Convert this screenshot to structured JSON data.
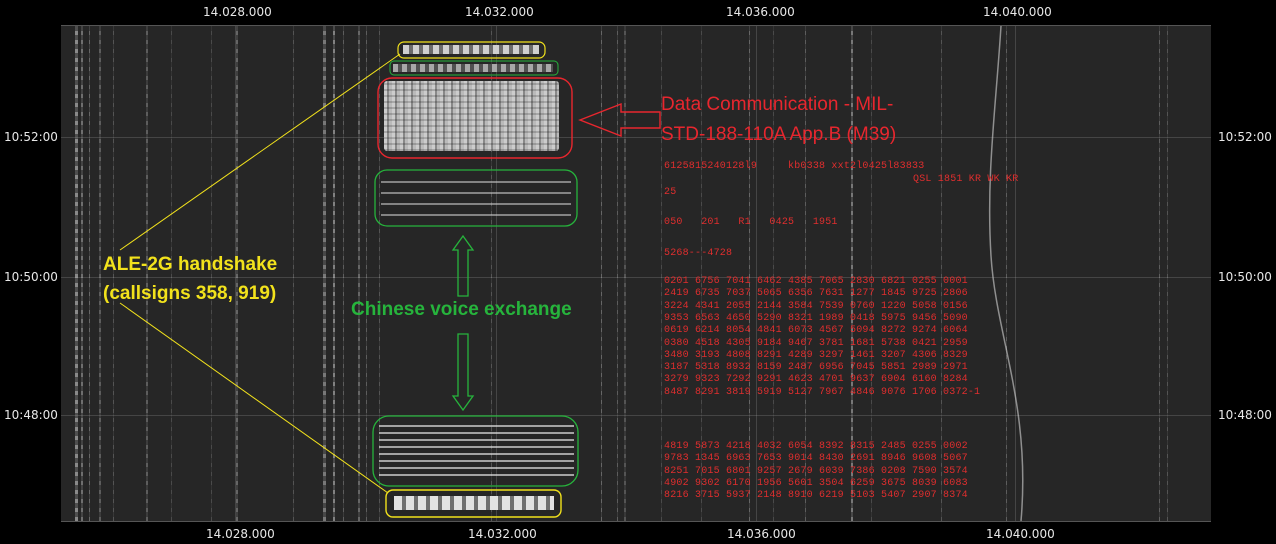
{
  "axis": {
    "top_ticks": [
      "14.028.000",
      "14.032.000",
      "14.036.000",
      "14.040.000"
    ],
    "bottom_ticks": [
      "14.028.000",
      "14.032.000",
      "14.036.000",
      "14.040.000"
    ],
    "left_ticks": [
      "10:52:00",
      "10:50:00",
      "10:48:00"
    ],
    "right_ticks": [
      "10:52:00",
      "10:50:00",
      "10:48:00"
    ]
  },
  "annotations": {
    "data_comm_line1": "Data Communication - MIL-",
    "data_comm_line2": "STD-188-110A App.B (M39)",
    "ale_line1": "ALE-2G handshake",
    "ale_line2": "(callsigns 358, 919)",
    "voice_label": "Chinese voice exchange"
  },
  "decoded": {
    "line1": "6125815240128l9     kb0338 xxt2l0425l83833",
    "line2": "QSL 1851 KR WK KR",
    "line3": "25",
    "line4": "050   201   R1   0425   1951",
    "line5": "5268---4728",
    "block1": [
      "0201 6756 7041 6462 4385 7065 2830 6821 0255 0001",
      "2419 6735 7037 5065 6356 7631 1277 1845 9725 2806",
      "3224 4341 2055 2144 3584 7539 0760 1220 5058 0156",
      "9353 6563 4650 5290 8321 1989 0418 5975 9456 5090",
      "0619 6214 8054 4841 6073 4567 5094 8272 9274 6064",
      "0380 4518 4305 9184 9467 3781 1681 5738 0421 2959",
      "3480 3193 4808 8291 4289 3297 1461 3207 4306 8329",
      "3187 5318 8932 8159 2487 6956 7045 5851 2989 2971",
      "3279 9323 7292 9291 4623 4701 9637 6904 6160 8284",
      "8487 8291 3819 5919 5127 7967 4846 9076 1706 0372-1"
    ],
    "block2": [
      "4819 5873 4218 4032 6054 8392 8315 2485 0255 0002",
      "9783 1345 6963 7653 9014 8430 2691 8946 9608 5067",
      "8251 7015 6801 9257 2679 6039 7386 0208 7590 3574",
      "4902 9302 6170 1956 5601 3504 6259 3675 8039 6083",
      "8216 3715 5937 2148 8910 6219 5103 5407 2907 8374"
    ]
  },
  "colors": {
    "data_comm": "#e8262e",
    "ale": "#f2e21c",
    "voice": "#26b43c",
    "decoded": "#e02e2e"
  }
}
